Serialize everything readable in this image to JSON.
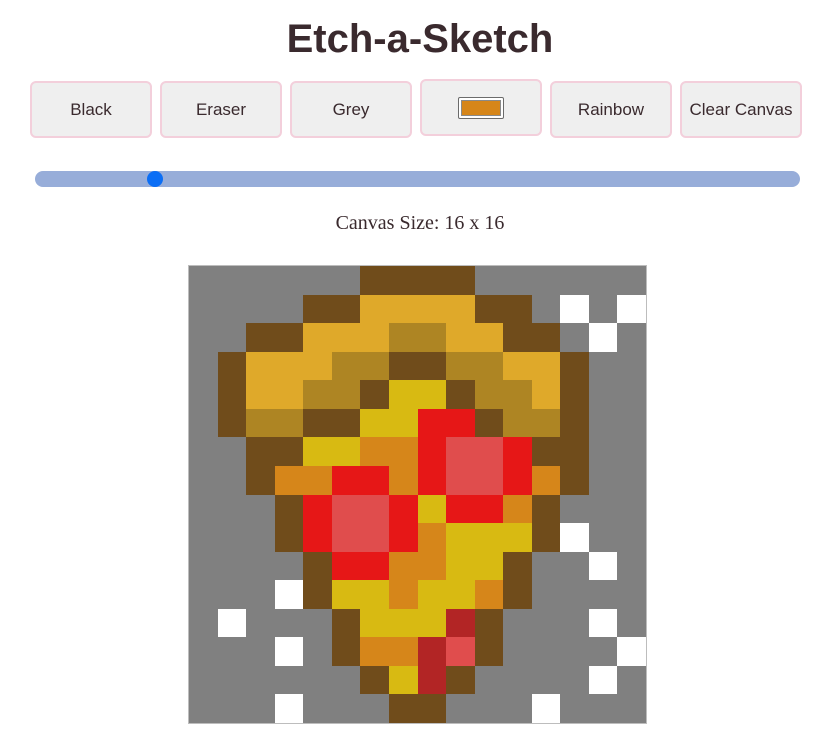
{
  "title": "Etch-a-Sketch",
  "buttons": {
    "black": "Black",
    "eraser": "Eraser",
    "grey": "Grey",
    "rainbow": "Rainbow",
    "clear": "Clear Canvas"
  },
  "color_picker": {
    "value": "#d6861a"
  },
  "slider": {
    "value": 16,
    "fraction": 0.15
  },
  "canvas_size_label": "Canvas Size: 16 x 16",
  "canvas": {
    "size": 16,
    "palette": {
      "G": "#808080",
      "W": "#ffffff",
      "B": "#704c1b",
      "Y": "#dfa92a",
      "O": "#ae8523",
      "L": "#d8ba12",
      "N": "#d6861a",
      "R": "#e61717",
      "P": "#e04d4d",
      "D": "#b22525"
    },
    "rows": [
      "GGGGGGBBBBGGGGGG",
      "GGGGBBYYYYBBGWGW",
      "GGBBYYYOOYYBBGWG",
      "GBYYYOOBBOOYYBGG",
      "GBYYOOBLLBOOYBGG",
      "GBOOBBLLRRBOOBGG",
      "GGBBLLNNRPPRBBGG",
      "GGBNNRRNRPPRNBGG",
      "GGGBRPPRLRRNBGGG",
      "GGGBRPPRNLLLBWGG",
      "GGGGBRRNNLLBGGWG",
      "GGGWBLLNLLNBGGGG",
      "GWGGGBLLLDBGGGWG",
      "GGGWGBNNDPBGGGGW",
      "GGGGGGBLDBGGGGWG",
      "GGGWGGGBBGGGWGGG"
    ]
  }
}
